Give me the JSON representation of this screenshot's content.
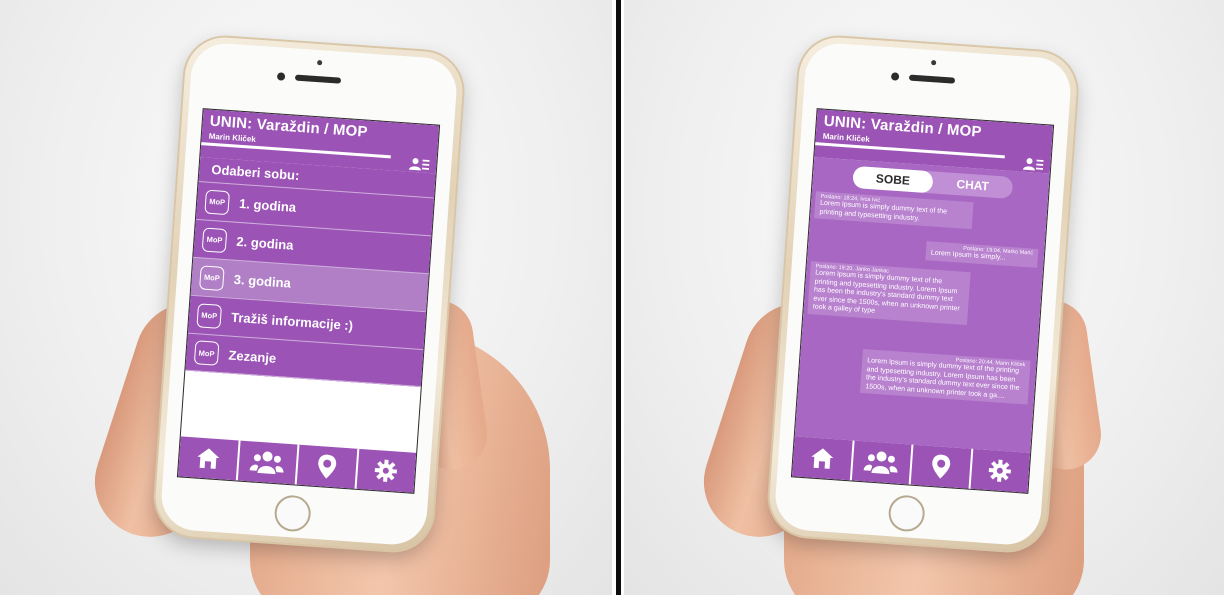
{
  "app": {
    "title": "UNIN: Varaždin / MOP",
    "user": "Marin Kliček",
    "accent_color": "#9b54b5"
  },
  "rooms_screen": {
    "prompt": "Odaberi sobu:",
    "badge": "MoP",
    "rooms": [
      {
        "label": "1. godina"
      },
      {
        "label": "2. godina"
      },
      {
        "label": "3. godina",
        "selected": true
      },
      {
        "label": "Tražiš informacije :)"
      },
      {
        "label": "Zezanje"
      }
    ]
  },
  "chat_screen": {
    "tabs": [
      {
        "label": "SOBE",
        "active": true
      },
      {
        "label": "CHAT",
        "active": false
      }
    ],
    "messages": [
      {
        "meta": "Poslano: 18:24, Ivca Ivić",
        "text": "Lorem Ipsum is simply dummy text of the printing and typesetting industry.",
        "side": "left"
      },
      {
        "meta": "Poslano: 19:04, Marko Marić",
        "text": "Lorem Ipsum is simply...",
        "side": "right"
      },
      {
        "meta": "Poslano: 19:20, Janko Jankac",
        "text": "Lorem Ipsum is simply dummy text of the printing and typesetting industry. Lorem Ipsum has been the industry's standard dummy text ever since the 1500s, when an unknown printer took a galley of type",
        "side": "left"
      },
      {
        "meta": "Poslano: 20:44, Marin Kliček",
        "text": "Lorem Ipsum is simply dummy text of the printing and typesetting industry. Lorem Ipsum has been the industry's standard dummy text ever since the 1500s, when an unknown printer took a ga....",
        "side": "right"
      }
    ]
  },
  "nav": {
    "items": [
      {
        "icon": "home-icon"
      },
      {
        "icon": "group-icon"
      },
      {
        "icon": "location-pin-icon"
      },
      {
        "icon": "gear-icon"
      }
    ]
  }
}
